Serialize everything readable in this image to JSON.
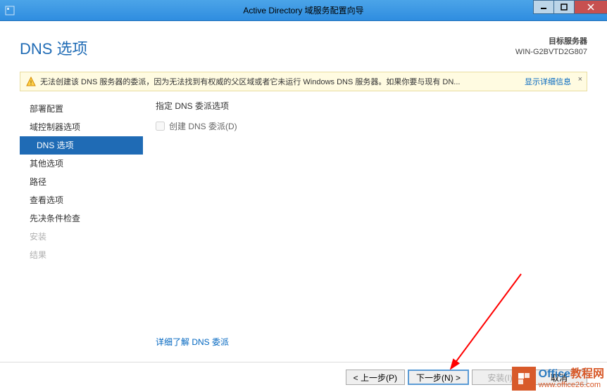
{
  "titlebar": {
    "title": "Active Directory 域服务配置向导"
  },
  "header": {
    "page_title": "DNS 选项",
    "target_label": "目标服务器",
    "target_value": "WIN-G2BVTD2G807"
  },
  "warning": {
    "text": "无法创建该 DNS 服务器的委派，因为无法找到有权威的父区域或者它未运行 Windows DNS 服务器。如果你要与现有 DN...",
    "link": "显示详细信息",
    "close": "×"
  },
  "sidebar": {
    "items": [
      {
        "label": "部署配置",
        "active": false,
        "disabled": false
      },
      {
        "label": "域控制器选项",
        "active": false,
        "disabled": false
      },
      {
        "label": "DNS 选项",
        "active": true,
        "disabled": false
      },
      {
        "label": "其他选项",
        "active": false,
        "disabled": false
      },
      {
        "label": "路径",
        "active": false,
        "disabled": false
      },
      {
        "label": "查看选项",
        "active": false,
        "disabled": false
      },
      {
        "label": "先决条件检查",
        "active": false,
        "disabled": false
      },
      {
        "label": "安装",
        "active": false,
        "disabled": true
      },
      {
        "label": "结果",
        "active": false,
        "disabled": true
      }
    ]
  },
  "main": {
    "section_label": "指定 DNS 委派选项",
    "checkbox_label": "创建 DNS 委派(D)",
    "more_link": "详细了解 DNS 委派"
  },
  "buttons": {
    "prev": "< 上一步(P)",
    "next": "下一步(N) >",
    "install": "安装(I)",
    "cancel": "取消"
  },
  "watermark": {
    "line1a": "Office",
    "line1b": "教程网",
    "line2": "www.office26.com"
  }
}
